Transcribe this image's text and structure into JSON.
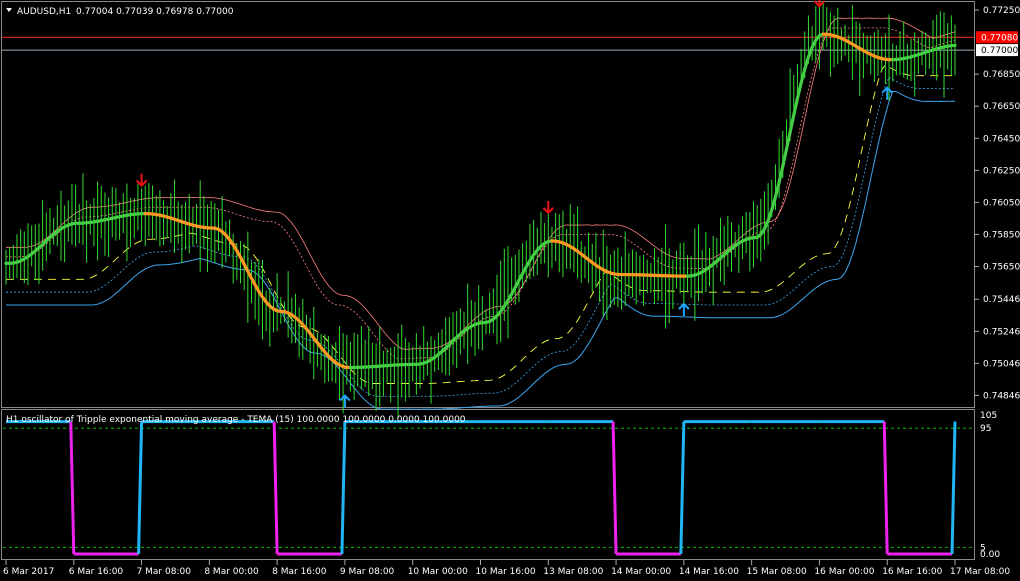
{
  "header": {
    "symbol": "AUDUSD,H1",
    "quote": "0.77004 0.77039 0.76978 0.77000"
  },
  "oscillator_caption": "H1 oscillator of Tripple exponential moving average - TEMA (15) 100.0000 100.0000 0.0000 100.0000",
  "price_axis": {
    "ticks": [
      "0.77250",
      "0.76850",
      "0.76650",
      "0.76450",
      "0.76250",
      "0.76050",
      "0.75850",
      "0.75650",
      "0.75446",
      "0.75246",
      "0.75046",
      "0.74846"
    ],
    "ylim": [
      0.7478,
      0.773
    ]
  },
  "price_tags": [
    {
      "value": "0.77080",
      "bg": "#ff0000",
      "fg": "#ffffff"
    },
    {
      "value": "0.77000",
      "bg": "#ffffff",
      "fg": "#000000"
    }
  ],
  "osc_axis": {
    "ticks": [
      "105",
      "95",
      "5",
      "0.00"
    ],
    "ylim": [
      -3,
      108
    ]
  },
  "time_axis": [
    "6 Mar 2017",
    "6 Mar 16:00",
    "7 Mar 08:00",
    "8 Mar 00:00",
    "8 Mar 16:00",
    "9 Mar 08:00",
    "10 Mar 00:00",
    "10 Mar 16:00",
    "13 Mar 08:00",
    "14 Mar 00:00",
    "14 Mar 16:00",
    "15 Mar 08:00",
    "16 Mar 00:00",
    "16 Mar 16:00",
    "17 Mar 08:00"
  ],
  "colors": {
    "candles": "#33dd33",
    "tema_up": "#44cc44",
    "tema_down": "#ff9922",
    "res_band": "#ff8080",
    "sup_band": "#3da6f0",
    "mid_band": "#ffff44",
    "osc_up": "#22b5f5",
    "osc_down": "#ee22ee",
    "level": "#00bb00",
    "arrow_up": "#1fa6ff",
    "arrow_down": "#ee1111"
  },
  "chart_data": [
    {
      "type": "line",
      "title": "AUDUSD,H1",
      "x": [
        "6 Mar 2017",
        "6 Mar 16:00",
        "7 Mar 08:00",
        "8 Mar 00:00",
        "8 Mar 16:00",
        "9 Mar 08:00",
        "10 Mar 00:00",
        "10 Mar 16:00",
        "13 Mar 08:00",
        "14 Mar 00:00",
        "14 Mar 16:00",
        "15 Mar 08:00",
        "16 Mar 00:00",
        "16 Mar 16:00",
        "17 Mar 08:00"
      ],
      "series": [
        {
          "values": [
            0.7567,
            0.7592,
            0.7598,
            0.7589,
            0.7537,
            0.7502,
            0.7504,
            0.753,
            0.7581,
            0.756,
            0.7559,
            0.7583,
            0.771,
            0.7694,
            0.7703
          ]
        }
      ],
      "ylim": [
        0.7478,
        0.773
      ],
      "horizontal_lines": [
        0.7708,
        0.77
      ]
    },
    {
      "type": "line",
      "title": "H1 oscillator of Tripple exponential moving average - TEMA (15) 100.0000 100.0000 0.0000 100.0000",
      "ylim": [
        -3,
        108
      ],
      "levels": [
        95,
        5
      ],
      "x": [
        "6 Mar 2017",
        "6 Mar 16:00",
        "7 Mar 08:00",
        "8 Mar 00:00",
        "8 Mar 16:00",
        "9 Mar 08:00",
        "10 Mar 00:00",
        "10 Mar 16:00",
        "13 Mar 08:00",
        "14 Mar 00:00",
        "14 Mar 16:00",
        "15 Mar 08:00",
        "16 Mar 00:00",
        "16 Mar 16:00",
        "17 Mar 08:00"
      ],
      "series": [
        {
          "values": [
            100,
            0,
            100,
            100,
            0,
            100,
            100,
            100,
            100,
            0,
            100,
            100,
            100,
            0,
            100
          ]
        }
      ]
    }
  ]
}
